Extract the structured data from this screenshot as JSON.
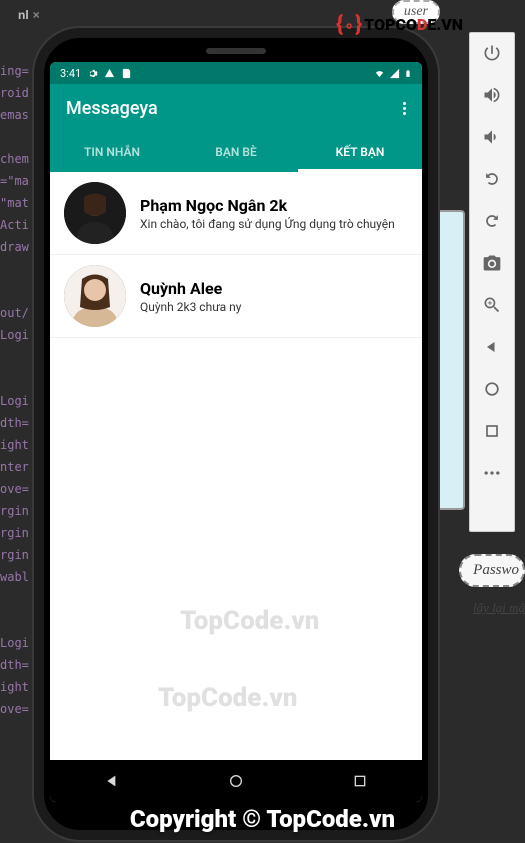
{
  "bg": {
    "tab_label": "nl",
    "user_label": "user",
    "code_lines": "ing=\nroid\nemas\n\nchem\n=\"ma\n\"mat\nActi\ndraw\n\n\nout/\nLogi\n\n\nLogi\ndth=\night\nnter\nove=\nrgin\nrgin\nrgin\nwabl\n\n\nLogi\ndth=\night\nove=",
    "password_label": "Passwo",
    "recover_label": "lấy lại mậ"
  },
  "logo": {
    "text_left": "TOPC",
    "text_d": "D",
    "text_right": "E.VN"
  },
  "status": {
    "time": "3:41"
  },
  "app": {
    "title": "Messageya"
  },
  "tabs": [
    {
      "label": "TIN NHẮN",
      "active": false
    },
    {
      "label": "BẠN BÈ",
      "active": false
    },
    {
      "label": "KẾT BẠN",
      "active": true
    }
  ],
  "contacts": [
    {
      "name": "Phạm Ngọc Ngân 2k",
      "subtitle": "Xin chào, tôi đang sử dụng Ứng dụng trò chuyện"
    },
    {
      "name": "Quỳnh Alee",
      "subtitle": "Quỳnh 2k3 chưa ny"
    }
  ],
  "watermark": {
    "text": "TopCode.vn"
  },
  "copyright": {
    "text": "Copyright © TopCode.vn"
  }
}
